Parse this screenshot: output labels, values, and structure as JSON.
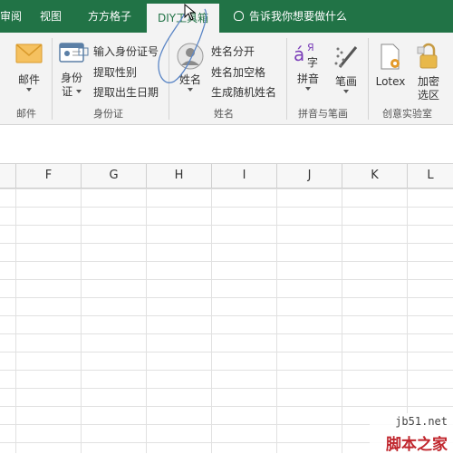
{
  "tabs": [
    {
      "label": "审阅",
      "active": false
    },
    {
      "label": "视图",
      "active": false
    },
    {
      "label": "方方格子",
      "active": false
    },
    {
      "label": "DIY工具箱",
      "active": true
    }
  ],
  "tell_me": "告诉我你想要做什么",
  "ribbon": {
    "mail": {
      "button": "邮件",
      "group": "邮件"
    },
    "idcard": {
      "button_line1": "身份",
      "button_line2": "证",
      "items": [
        "输入身份证号",
        "提取性别",
        "提取出生日期"
      ],
      "group": "身份证"
    },
    "name": {
      "button": "姓名",
      "items": [
        "姓名分开",
        "姓名加空格",
        "生成随机姓名"
      ],
      "group": "姓名"
    },
    "pinyin": {
      "pinyin_label": "拼音",
      "stroke_label": "笔画",
      "group": "拼音与笔画",
      "glyph_a": "á",
      "glyph_zi": "字",
      "glyph_ya": "Я"
    },
    "lab": {
      "lotex_label": "Lotex",
      "encrypt_line1": "加密",
      "encrypt_line2": "选区",
      "group": "创意实验室"
    }
  },
  "columns": [
    "F",
    "G",
    "H",
    "I",
    "J",
    "K",
    "L"
  ],
  "watermark": {
    "line1": "jb51.net",
    "line2": "脚本之家"
  },
  "colors": {
    "accent": "#217346",
    "ribbon_bg": "#f3f3f3",
    "watermark_red": "#c0262d"
  }
}
